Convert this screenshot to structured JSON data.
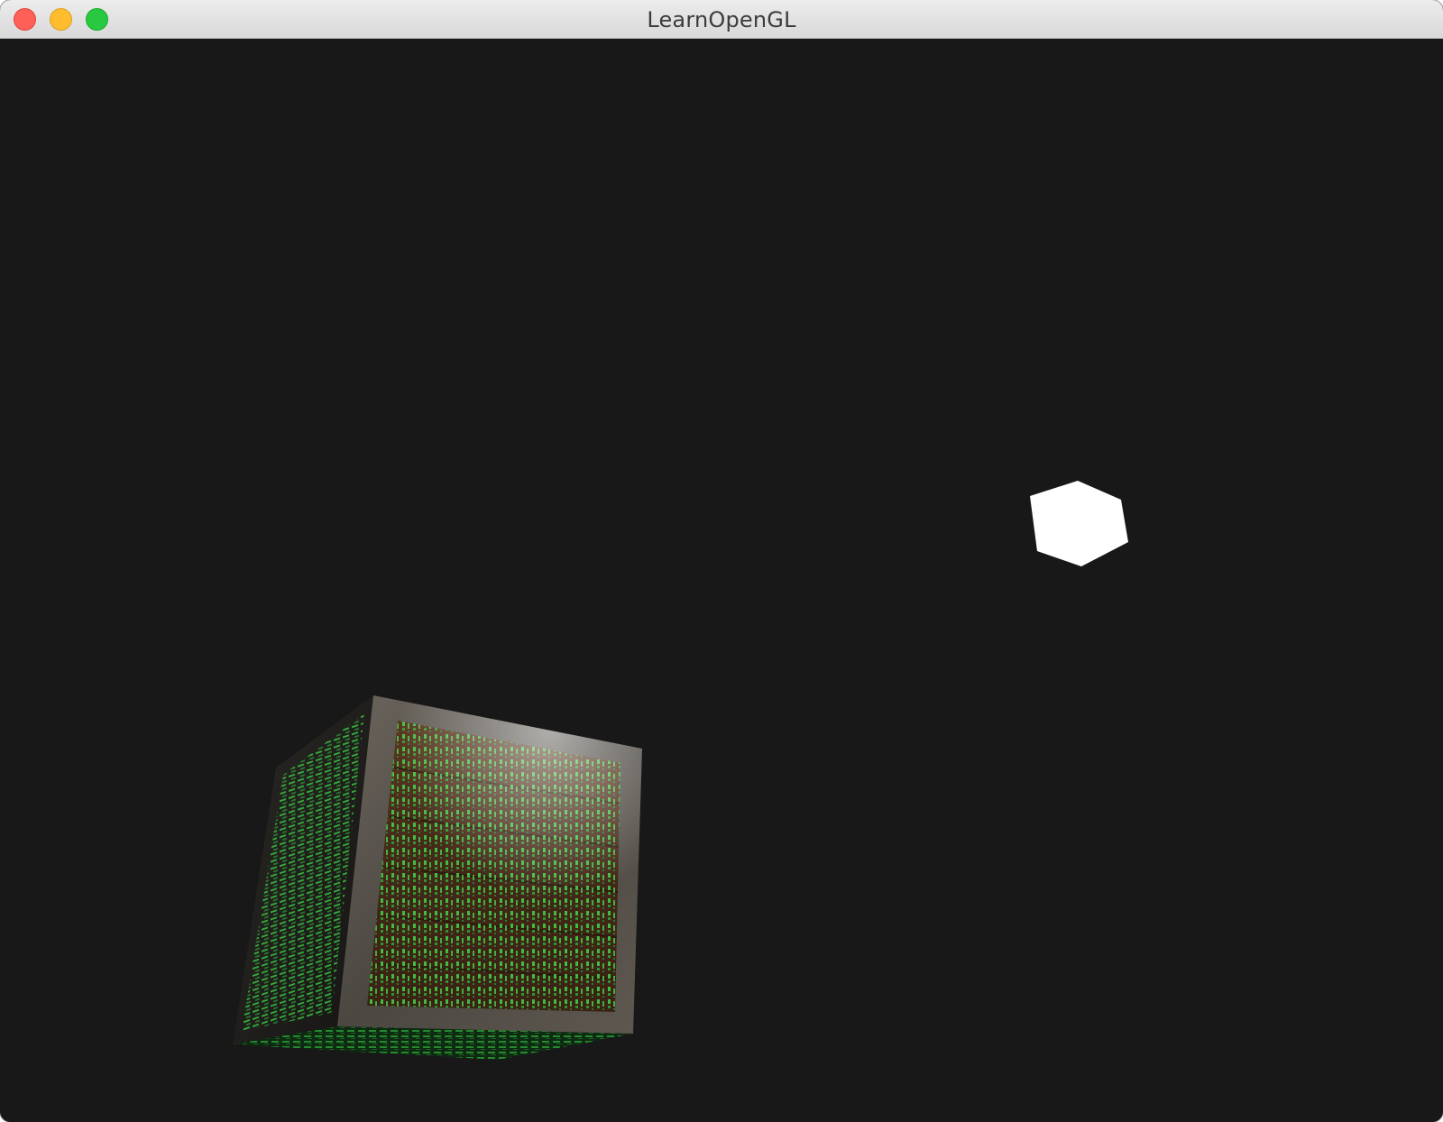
{
  "window": {
    "title": "LearnOpenGL",
    "buttons": {
      "close": "close-button",
      "minimize": "minimize-button",
      "zoom": "zoom-button"
    }
  },
  "scene": {
    "background_color": "#181818",
    "light_cube_color": "#ffffff",
    "container_glow_color": "#2fd23a",
    "container_wood_color": "#4a2a1a",
    "container_metal_color": "#5a554f"
  }
}
